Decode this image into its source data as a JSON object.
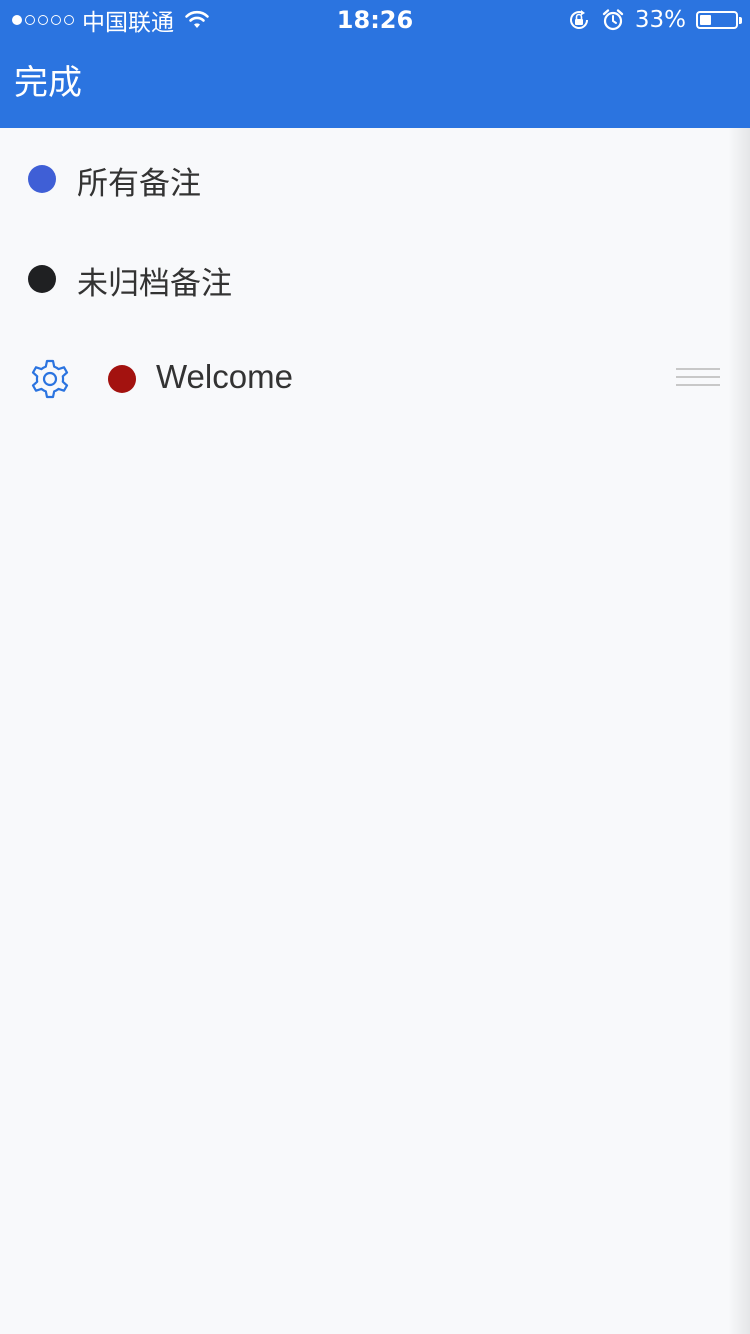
{
  "status_bar": {
    "carrier": "中国联通",
    "time": "18:26",
    "battery_percent": "33%",
    "battery_level": 0.33,
    "signal_bars_filled": 1,
    "signal_bars_total": 5,
    "icons": [
      "wifi-icon",
      "orientation-lock-icon",
      "alarm-icon",
      "battery-icon"
    ]
  },
  "nav": {
    "done_label": "完成"
  },
  "list": {
    "items": [
      {
        "label": "所有备注",
        "dot_color": "#3f5fd6"
      },
      {
        "label": "未归档备注",
        "dot_color": "#1f2022"
      },
      {
        "label": "Welcome",
        "dot_color": "#a3120f"
      }
    ]
  },
  "colors": {
    "accent": "#2b74e0",
    "background": "#f8f9fb",
    "text": "#333333",
    "gear": "#2b74e0",
    "handle": "#c8c8c8"
  }
}
